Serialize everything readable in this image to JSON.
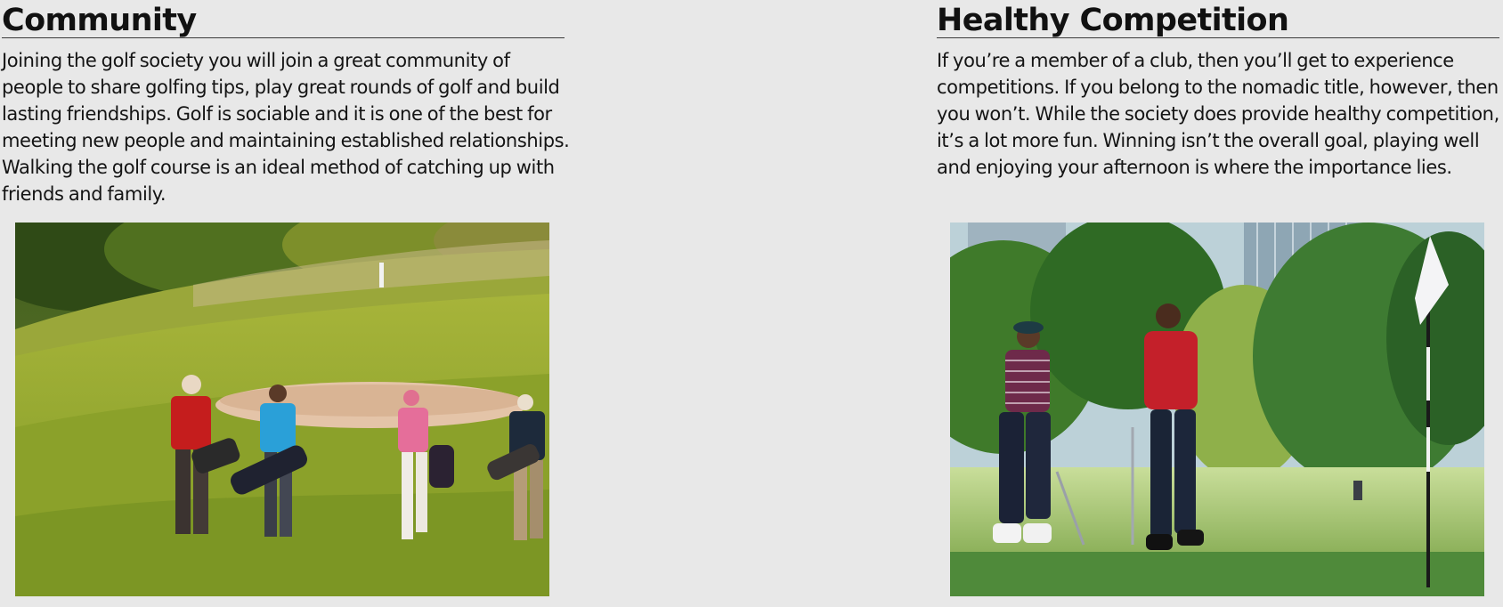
{
  "sections": [
    {
      "heading": "Community",
      "body": "Joining the golf society you will join a great community of people to share golfing tips, play great rounds of golf and build lasting friendships. Golf is sociable and it is one of the best for meeting new people and maintaining established relationships. Walking the golf course is an ideal method of catching up with friends and family."
    },
    {
      "heading": "Healthy Competition",
      "body": "If you’re a member of a club, then you’ll get to experience competitions. If you belong to the nomadic title, however, then you won’t. While the society does provide healthy competition, it’s a lot more fun. Winning isn’t the overall goal, playing well and enjoying your afternoon is where the importance lies."
    }
  ]
}
